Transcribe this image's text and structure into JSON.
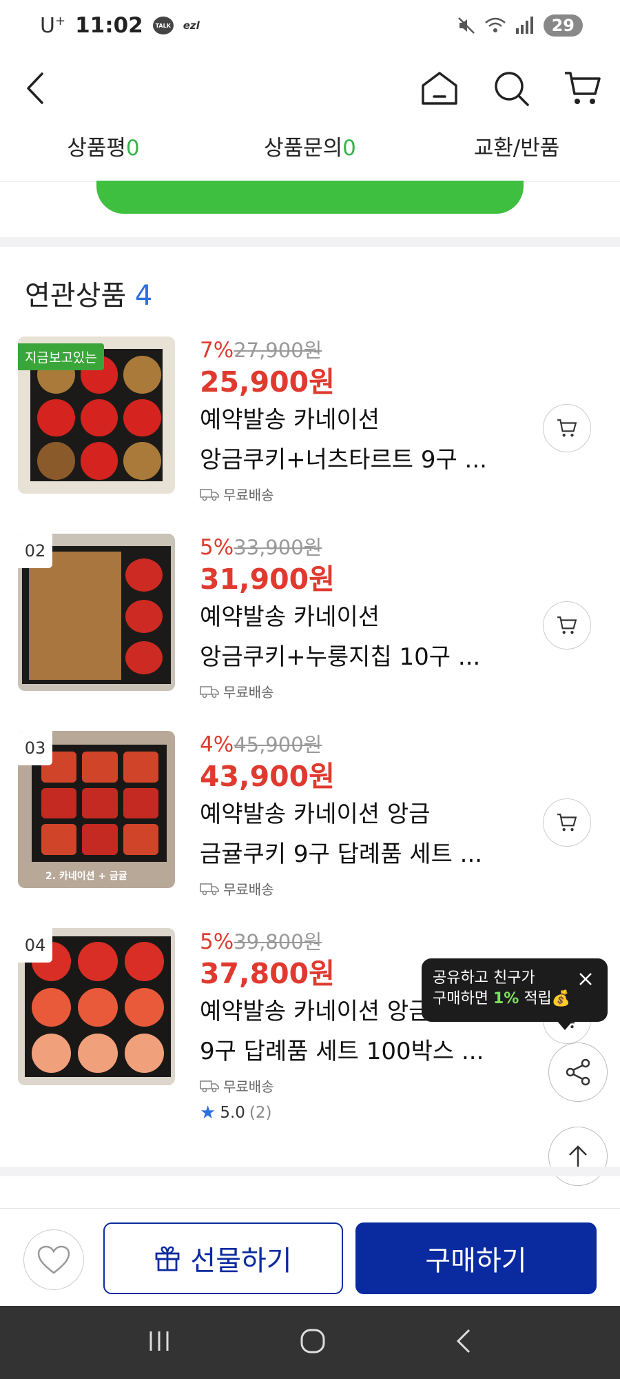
{
  "status_bar": {
    "carrier": "U",
    "carrier_sup": "+",
    "time": "11:02",
    "talk": "TALK",
    "ezl": "ezl",
    "battery": "29"
  },
  "header": {
    "back_icon": "chevron-left-icon",
    "home_icon": "home-icon",
    "search_icon": "search-icon",
    "cart_icon": "cart-icon"
  },
  "tabs": [
    {
      "label": "상품평",
      "count": "0"
    },
    {
      "label": "상품문의",
      "count": "0"
    },
    {
      "label": "교환/반품",
      "count": ""
    }
  ],
  "related": {
    "title": "연관상품",
    "count": "4",
    "products": [
      {
        "badge": "지금보고있는",
        "discount": "7%",
        "original_price": "27,900원",
        "price": "25,900원",
        "name_line1": "예약발송 카네이션",
        "name_line2": "앙금쿠키+너츠타르트 9구 ...",
        "shipping": "무료배송",
        "caption": ""
      },
      {
        "badge": "02",
        "discount": "5%",
        "original_price": "33,900원",
        "price": "31,900원",
        "name_line1": "예약발송 카네이션",
        "name_line2": "앙금쿠키+누룽지칩 10구 ...",
        "shipping": "무료배송",
        "caption": ""
      },
      {
        "badge": "03",
        "discount": "4%",
        "original_price": "45,900원",
        "price": "43,900원",
        "name_line1": "예약발송 카네이션 앙금",
        "name_line2": "금귤쿠키 9구 답례품 세트 ...",
        "shipping": "무료배송",
        "caption": "2. 카네이션 + 금귤"
      },
      {
        "badge": "04",
        "discount": "5%",
        "original_price": "39,800원",
        "price": "37,800원",
        "name_line1": "예약발송 카네이션 앙금쿠키",
        "name_line2": "9구 답례품 세트 100박스 ...",
        "shipping": "무료배송",
        "rating": "5.0",
        "rating_count": "(2)",
        "caption": ""
      }
    ]
  },
  "tooltip": {
    "line1": "공유하고 친구가",
    "line2_pre": "구매하면 ",
    "line2_hl": "1%",
    "line2_post": " 적립",
    "emoji": "💰"
  },
  "action_bar": {
    "wish_icon": "heart-icon",
    "gift_label": "선물하기",
    "gift_icon": "gift-icon",
    "buy_label": "구매하기"
  },
  "nav_bar": {
    "recent_icon": "recent-apps-icon",
    "home_icon": "home-circle-icon",
    "back_icon": "back-icon"
  },
  "colors": {
    "accent_blue": "#0a2aa0",
    "price_red": "#e03a2f",
    "green": "#35b549",
    "count_blue": "#2d6fe0"
  }
}
